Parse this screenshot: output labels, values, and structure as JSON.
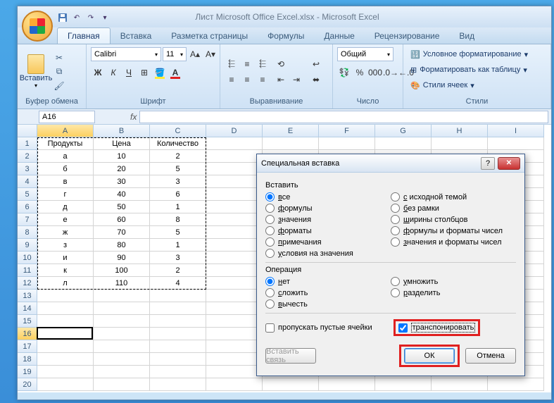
{
  "title": "Лист Microsoft Office Excel.xlsx - Microsoft Excel",
  "tabs": [
    "Главная",
    "Вставка",
    "Разметка страницы",
    "Формулы",
    "Данные",
    "Рецензирование",
    "Вид"
  ],
  "ribbon": {
    "clipboard": {
      "paste": "Вставить",
      "label": "Буфер обмена"
    },
    "font": {
      "name": "Calibri",
      "size": "11",
      "label": "Шрифт"
    },
    "align": {
      "label": "Выравнивание"
    },
    "number": {
      "format": "Общий",
      "label": "Число"
    },
    "styles": {
      "cond": "Условное форматирование",
      "table": "Форматировать как таблицу",
      "cell": "Стили ячеек",
      "label": "Стили"
    }
  },
  "namebox": "A16",
  "columns": [
    "A",
    "B",
    "C",
    "D",
    "E",
    "F",
    "G",
    "H",
    "I"
  ],
  "rows_count": 20,
  "headers": {
    "c0": "Продукты",
    "c1": "Цена",
    "c2": "Количество"
  },
  "data": [
    {
      "p": "а",
      "price": "10",
      "q": "2"
    },
    {
      "p": "б",
      "price": "20",
      "q": "5"
    },
    {
      "p": "в",
      "price": "30",
      "q": "3"
    },
    {
      "p": "г",
      "price": "40",
      "q": "6"
    },
    {
      "p": "д",
      "price": "50",
      "q": "1"
    },
    {
      "p": "е",
      "price": "60",
      "q": "8"
    },
    {
      "p": "ж",
      "price": "70",
      "q": "5"
    },
    {
      "p": "з",
      "price": "80",
      "q": "1"
    },
    {
      "p": "и",
      "price": "90",
      "q": "3"
    },
    {
      "p": "к",
      "price": "100",
      "q": "2"
    },
    {
      "p": "л",
      "price": "110",
      "q": "4"
    }
  ],
  "dialog": {
    "title": "Специальная вставка",
    "paste_label": "Вставить",
    "paste_left": [
      "все",
      "формулы",
      "значения",
      "форматы",
      "примечания",
      "условия на значения"
    ],
    "paste_right": [
      "с исходной темой",
      "без рамки",
      "ширины столбцов",
      "формулы и форматы чисел",
      "значения и форматы чисел"
    ],
    "op_label": "Операция",
    "op_left": [
      "нет",
      "сложить",
      "вычесть"
    ],
    "op_right": [
      "умножить",
      "разделить"
    ],
    "skip": "пропускать пустые ячейки",
    "transpose": "транспонировать",
    "link": "Вставить связь",
    "ok": "ОК",
    "cancel": "Отмена"
  }
}
